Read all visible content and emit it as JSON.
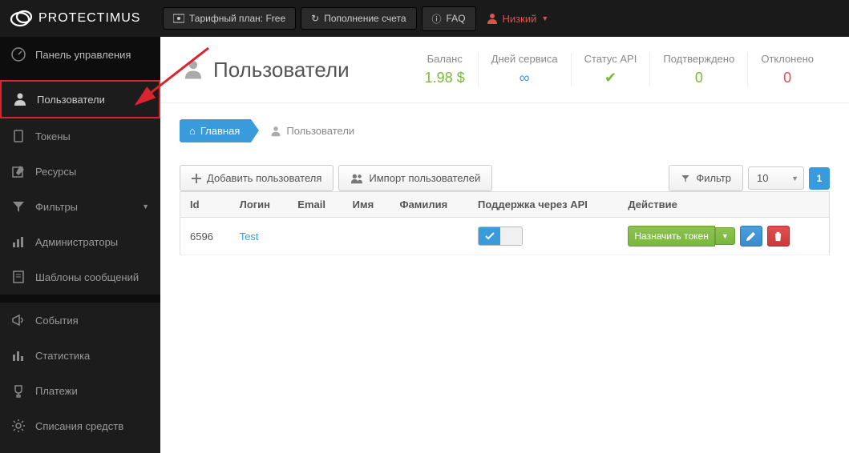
{
  "brand": "PROTECTIMUS",
  "topbar": {
    "plan": "Тарифный план: Free",
    "topup": "Пополнение счета",
    "faq": "FAQ",
    "user": "Низкий"
  },
  "sidebar": {
    "dashboard": "Панель управления",
    "users": "Пользователи",
    "tokens": "Токены",
    "resources": "Ресурсы",
    "filters": "Фильтры",
    "admins": "Администраторы",
    "templates": "Шаблоны сообщений",
    "events": "События",
    "statistics": "Статистика",
    "payments": "Платежи",
    "charges": "Списания средств"
  },
  "page": {
    "title": "Пользователи"
  },
  "stats": {
    "balance_lbl": "Баланс",
    "balance_val": "1.98 $",
    "days_lbl": "Дней сервиса",
    "api_lbl": "Статус API",
    "confirmed_lbl": "Подтверждено",
    "confirmed_val": "0",
    "rejected_lbl": "Отклонено",
    "rejected_val": "0"
  },
  "crumbs": {
    "home": "Главная",
    "current": "Пользователи"
  },
  "toolbar": {
    "add": "Добавить пользователя",
    "import": "Импорт пользователей",
    "filter": "Фильтр",
    "pagesize": "10",
    "page": "1"
  },
  "table": {
    "headers": {
      "id": "Id",
      "login": "Логин",
      "email": "Email",
      "name": "Имя",
      "surname": "Фамилия",
      "api": "Поддержка через API",
      "action": "Действие"
    },
    "row": {
      "id": "6596",
      "login": "Test",
      "assign": "Назначить токен"
    }
  }
}
